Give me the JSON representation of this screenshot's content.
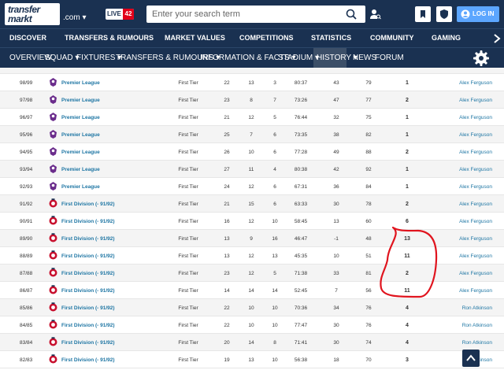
{
  "header": {
    "logo_line1": "transfer",
    "logo_line2": "markt",
    "domain": ".com",
    "live_label": "LIVE",
    "live_count": "42",
    "search_placeholder": "Enter your search term",
    "login_label": "LOG IN"
  },
  "main_nav": [
    "DISCOVER",
    "TRANSFERS & RUMOURS",
    "MARKET VALUES",
    "COMPETITIONS",
    "STATISTICS",
    "COMMUNITY",
    "GAMING"
  ],
  "sub_nav": [
    {
      "label": "OVERVIEW"
    },
    {
      "label": "SQUAD",
      "dropdown": true
    },
    {
      "label": "FIXTURES",
      "dropdown": true
    },
    {
      "label": "TRANSFERS & RUMOURS",
      "dropdown": true
    },
    {
      "label": "INFORMATION & FACTS",
      "dropdown": true
    },
    {
      "label": "STADIUM",
      "dropdown": true
    },
    {
      "label": "HISTORY",
      "dropdown": true,
      "active": true
    },
    {
      "label": "NEWS"
    },
    {
      "label": "FORUM"
    }
  ],
  "rows": [
    {
      "season": "98/99",
      "competition": "Premier League",
      "type": "pl",
      "tier": "First Tier",
      "w": "22",
      "d": "13",
      "l": "3",
      "goals": "80:37",
      "gd": "43",
      "pts": "79",
      "pos": "1",
      "manager": "Alex Ferguson"
    },
    {
      "season": "97/98",
      "competition": "Premier League",
      "type": "pl",
      "tier": "First Tier",
      "w": "23",
      "d": "8",
      "l": "7",
      "goals": "73:26",
      "gd": "47",
      "pts": "77",
      "pos": "2",
      "manager": "Alex Ferguson"
    },
    {
      "season": "96/97",
      "competition": "Premier League",
      "type": "pl",
      "tier": "First Tier",
      "w": "21",
      "d": "12",
      "l": "5",
      "goals": "76:44",
      "gd": "32",
      "pts": "75",
      "pos": "1",
      "manager": "Alex Ferguson"
    },
    {
      "season": "95/96",
      "competition": "Premier League",
      "type": "pl",
      "tier": "First Tier",
      "w": "25",
      "d": "7",
      "l": "6",
      "goals": "73:35",
      "gd": "38",
      "pts": "82",
      "pos": "1",
      "manager": "Alex Ferguson"
    },
    {
      "season": "94/95",
      "competition": "Premier League",
      "type": "pl",
      "tier": "First Tier",
      "w": "26",
      "d": "10",
      "l": "6",
      "goals": "77:28",
      "gd": "49",
      "pts": "88",
      "pos": "2",
      "manager": "Alex Ferguson"
    },
    {
      "season": "93/94",
      "competition": "Premier League",
      "type": "pl",
      "tier": "First Tier",
      "w": "27",
      "d": "11",
      "l": "4",
      "goals": "80:38",
      "gd": "42",
      "pts": "92",
      "pos": "1",
      "manager": "Alex Ferguson"
    },
    {
      "season": "92/93",
      "competition": "Premier League",
      "type": "pl",
      "tier": "First Tier",
      "w": "24",
      "d": "12",
      "l": "6",
      "goals": "67:31",
      "gd": "36",
      "pts": "84",
      "pos": "1",
      "manager": "Alex Ferguson"
    },
    {
      "season": "91/92",
      "competition": "First Division (- 91/92)",
      "type": "fd",
      "tier": "First Tier",
      "w": "21",
      "d": "15",
      "l": "6",
      "goals": "63:33",
      "gd": "30",
      "pts": "78",
      "pos": "2",
      "manager": "Alex Ferguson"
    },
    {
      "season": "90/91",
      "competition": "First Division (- 91/92)",
      "type": "fd",
      "tier": "First Tier",
      "w": "16",
      "d": "12",
      "l": "10",
      "goals": "58:45",
      "gd": "13",
      "pts": "60",
      "pos": "6",
      "manager": "Alex Ferguson"
    },
    {
      "season": "89/90",
      "competition": "First Division (- 91/92)",
      "type": "fd",
      "tier": "First Tier",
      "w": "13",
      "d": "9",
      "l": "16",
      "goals": "46:47",
      "gd": "-1",
      "pts": "48",
      "pos": "13",
      "manager": "Alex Ferguson"
    },
    {
      "season": "88/89",
      "competition": "First Division (- 91/92)",
      "type": "fd",
      "tier": "First Tier",
      "w": "13",
      "d": "12",
      "l": "13",
      "goals": "45:35",
      "gd": "10",
      "pts": "51",
      "pos": "11",
      "manager": "Alex Ferguson"
    },
    {
      "season": "87/88",
      "competition": "First Division (- 91/92)",
      "type": "fd",
      "tier": "First Tier",
      "w": "23",
      "d": "12",
      "l": "5",
      "goals": "71:38",
      "gd": "33",
      "pts": "81",
      "pos": "2",
      "manager": "Alex Ferguson"
    },
    {
      "season": "86/87",
      "competition": "First Division (- 91/92)",
      "type": "fd",
      "tier": "First Tier",
      "w": "14",
      "d": "14",
      "l": "14",
      "goals": "52:45",
      "gd": "7",
      "pts": "56",
      "pos": "11",
      "manager": "Alex Ferguson"
    },
    {
      "season": "85/86",
      "competition": "First Division (- 91/92)",
      "type": "fd",
      "tier": "First Tier",
      "w": "22",
      "d": "10",
      "l": "10",
      "goals": "70:36",
      "gd": "34",
      "pts": "76",
      "pos": "4",
      "manager": "Ron Atkinson"
    },
    {
      "season": "84/85",
      "competition": "First Division (- 91/92)",
      "type": "fd",
      "tier": "First Tier",
      "w": "22",
      "d": "10",
      "l": "10",
      "goals": "77:47",
      "gd": "30",
      "pts": "76",
      "pos": "4",
      "manager": "Ron Atkinson"
    },
    {
      "season": "83/84",
      "competition": "First Division (- 91/92)",
      "type": "fd",
      "tier": "First Tier",
      "w": "20",
      "d": "14",
      "l": "8",
      "goals": "71:41",
      "gd": "30",
      "pts": "74",
      "pos": "4",
      "manager": "Ron Atkinson"
    },
    {
      "season": "82/83",
      "competition": "First Division (- 91/92)",
      "type": "fd",
      "tier": "First Tier",
      "w": "19",
      "d": "13",
      "l": "10",
      "goals": "56:38",
      "gd": "18",
      "pts": "70",
      "pos": "3",
      "manager": "Ron Atkinson"
    }
  ],
  "colors": {
    "navy": "#1a3151",
    "link": "#1d75a3",
    "annotation": "#e0141e",
    "live_red": "#e2001a",
    "login_blue": "#5ca6ff"
  }
}
